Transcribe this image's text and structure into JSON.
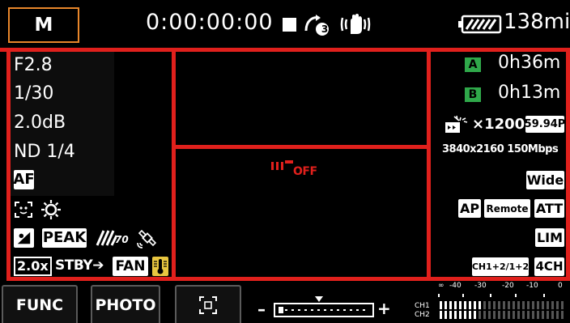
{
  "top_bar": {
    "mode": "M",
    "timecode_main": "0:00:00",
    "timecode_frames": "00",
    "image_stabilizer_level": "3",
    "battery_remaining": "138min"
  },
  "left_panel": {
    "aperture": "F2.8",
    "shutter": "1/30",
    "gain": "2.0dB",
    "nd_filter": "ND 1/4",
    "focus_mode": "AF",
    "peaking_label": "PEAK",
    "zebra_value": "70",
    "magnification": "2.0x",
    "standby_label": "STBY",
    "fan_label": "FAN"
  },
  "center": {
    "status_off_label": "OFF"
  },
  "right_panel": {
    "slot_a_label": "A",
    "slot_a_time": "0h36m",
    "slot_b_label": "B",
    "slot_b_time": "0h13m",
    "zoom_ratio": "×1200",
    "frame_rate": "59.94P",
    "resolution_bitrate": "3840x2160 150Mbps",
    "conversion_lens": "Wide",
    "ap_label": "AP",
    "remote_label": "Remote",
    "att_label": "ATT",
    "lim_label": "LIM",
    "audio_channels_config": "CH1+2/1+2",
    "audio_channels_count": "4CH"
  },
  "bottom_bar": {
    "func_button": "FUNC",
    "photo_button": "PHOTO",
    "zoom_minus": "–",
    "zoom_plus": "+",
    "zoom_position": 0.45,
    "audio_meter_scale": [
      "∞",
      "-40",
      "-30",
      "-20",
      "-10",
      "0"
    ],
    "ch1_label": "CH1",
    "ch2_label": "CH2"
  },
  "colors": {
    "frame_red": "#e0201c",
    "mode_orange": "#e8862a",
    "media_green": "#2fa84a",
    "fan_yellow": "#e8c640"
  }
}
